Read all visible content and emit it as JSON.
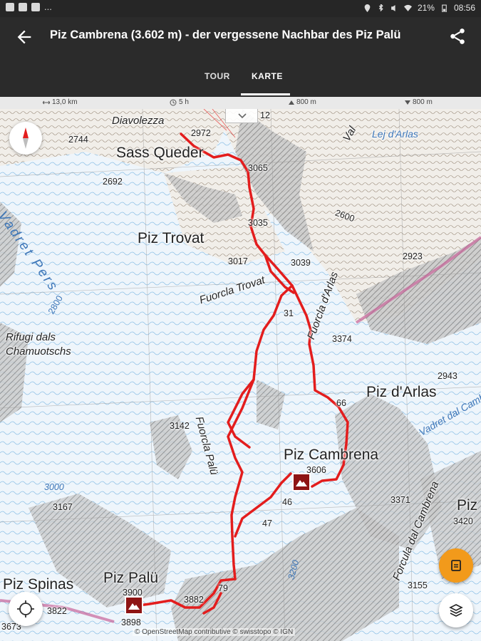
{
  "status_bar": {
    "battery": "21%",
    "time": "08:56",
    "overflow": "..."
  },
  "app_bar": {
    "title": "Piz Cambrena (3.602 m) - der vergessene Nachbar des Piz Palü",
    "back_icon": "arrow-back-icon",
    "share_icon": "share-icon"
  },
  "tabs": [
    {
      "label": "TOUR",
      "selected": false
    },
    {
      "label": "KARTE",
      "selected": true
    }
  ],
  "stats": {
    "distance": "13,0 km",
    "duration": "5 h",
    "ascent": "800 m",
    "descent": "800 m"
  },
  "map": {
    "labels": {
      "diavolezza": "Diavolezza",
      "sass_queder": "Sass Queder",
      "piz_trovat": "Piz Trovat",
      "fuorcla_trovat": "Fuorcla Trovat",
      "vadret_pers": "Vadret Pers",
      "rifugi": "Rifugi dals",
      "chamuotschs": "Chamuotschs",
      "lej_arlas": "Lej d'Arlas",
      "fuorcla_arlas": "Fuorcla d'Arlas",
      "piz_arlas": "Piz d'Arlas",
      "piz_cambrena": "Piz Cambrena",
      "vadret_cambrena": "Vadret dal Cambrena",
      "forcula_cambrena": "Forcula dal Cambrena",
      "fuorcla_palu": "Fuorcla Palü",
      "piz_palu": "Piz Palü",
      "piz_spinas": "Piz Spinas",
      "piz_right": "Piz",
      "val": "Val"
    },
    "elevations": {
      "e2744": "2744",
      "e2972": "2972",
      "e2692": "2692",
      "e3065": "3065",
      "e2600": "2600",
      "e3035": "3035",
      "e2923": "2923",
      "e3017": "3017",
      "e3039": "3039",
      "e2800": "2800",
      "e3374": "3374",
      "e2943": "2943",
      "e3142": "3142",
      "e3606": "3606",
      "e3000": "3000",
      "e3167": "3167",
      "e3371": "3371",
      "e3420": "3420",
      "e3200": "3200",
      "e3900": "3900",
      "e3882": "3882",
      "e3822": "3822",
      "e3898": "3898",
      "e3155": "3155",
      "e3673": "3673",
      "e12": "12",
      "e66": "66",
      "e46": "46",
      "e47": "47",
      "e79": "79",
      "e31": "31"
    },
    "attribution": "© OpenStreetMap contributive © swisstopo © IGN",
    "route_color": "#e31d1d",
    "summit_marker_color": "#8e1414",
    "controls": {
      "compass_icon": "compass-icon",
      "collapse_icon": "chevron-down-icon",
      "offline_icon": "map-download-icon",
      "layers_icon": "layers-icon",
      "locate_icon": "locate-icon"
    }
  }
}
